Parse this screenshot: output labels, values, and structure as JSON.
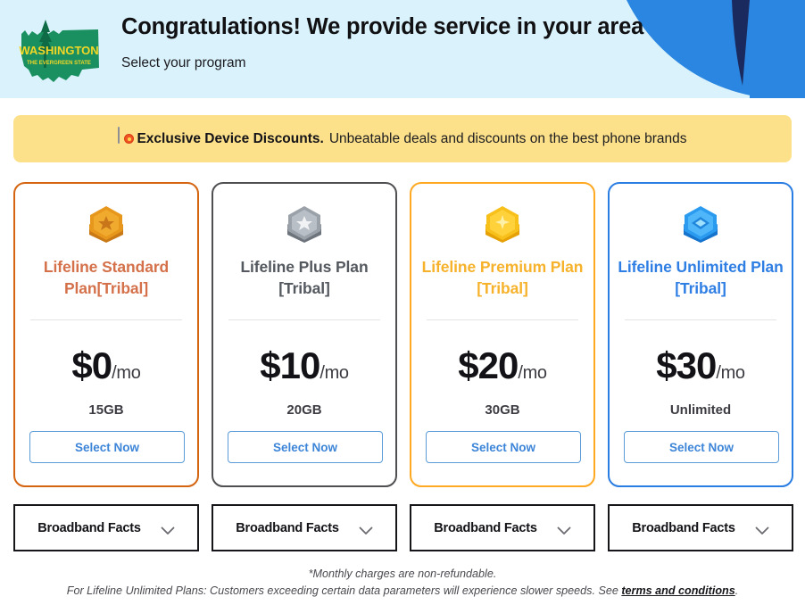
{
  "header": {
    "title": "Congratulations! We provide service in your area",
    "subtitle": "Select your program",
    "logo": {
      "state_name": "WASHINGTON",
      "state_motto": "THE EVERGREEN STATE"
    },
    "bg_color": "#d9f2fb",
    "accent_color": "#2a86e0"
  },
  "banner": {
    "strong_text": "Exclusive Device Discounts.",
    "text": "Unbeatable deals and discounts on the best phone brands",
    "bg_color": "#fde18a",
    "icon": "phone-discount-icon"
  },
  "plans": [
    {
      "badge": "bronze-hex-star-badge",
      "title": "Lifeline Standard Plan[Tribal]",
      "price": "$0",
      "period": "/mo",
      "data": "15GB",
      "cta": "Select Now",
      "border_color": "#d4640f",
      "title_color": "#d4714a",
      "facts_label": "Broadband Facts"
    },
    {
      "badge": "silver-hex-star-badge",
      "title": "Lifeline Plus Plan [Tribal]",
      "price": "$10",
      "period": "/mo",
      "data": "20GB",
      "cta": "Select Now",
      "border_color": "#4f4f52",
      "title_color": "#54585f",
      "facts_label": "Broadband Facts"
    },
    {
      "badge": "gold-hex-star-badge",
      "title": "Lifeline Premium Plan [Tribal]",
      "price": "$20",
      "period": "/mo",
      "data": "30GB",
      "cta": "Select Now",
      "border_color": "#ffa922",
      "title_color": "#f6b22b",
      "facts_label": "Broadband Facts"
    },
    {
      "badge": "blue-hex-diamond-badge",
      "title": "Lifeline Unlimited Plan [Tribal]",
      "price": "$30",
      "period": "/mo",
      "data": "Unlimited",
      "cta": "Select Now",
      "border_color": "#2a7de2",
      "title_color": "#2e7ee4",
      "facts_label": "Broadband Facts"
    }
  ],
  "footer": {
    "line1": "*Monthly charges are non-refundable.",
    "line2_before": "For Lifeline Unlimited Plans: Customers exceeding certain data parameters will experience slower speeds. See ",
    "link_text": "terms and conditions",
    "line2_after": "."
  }
}
